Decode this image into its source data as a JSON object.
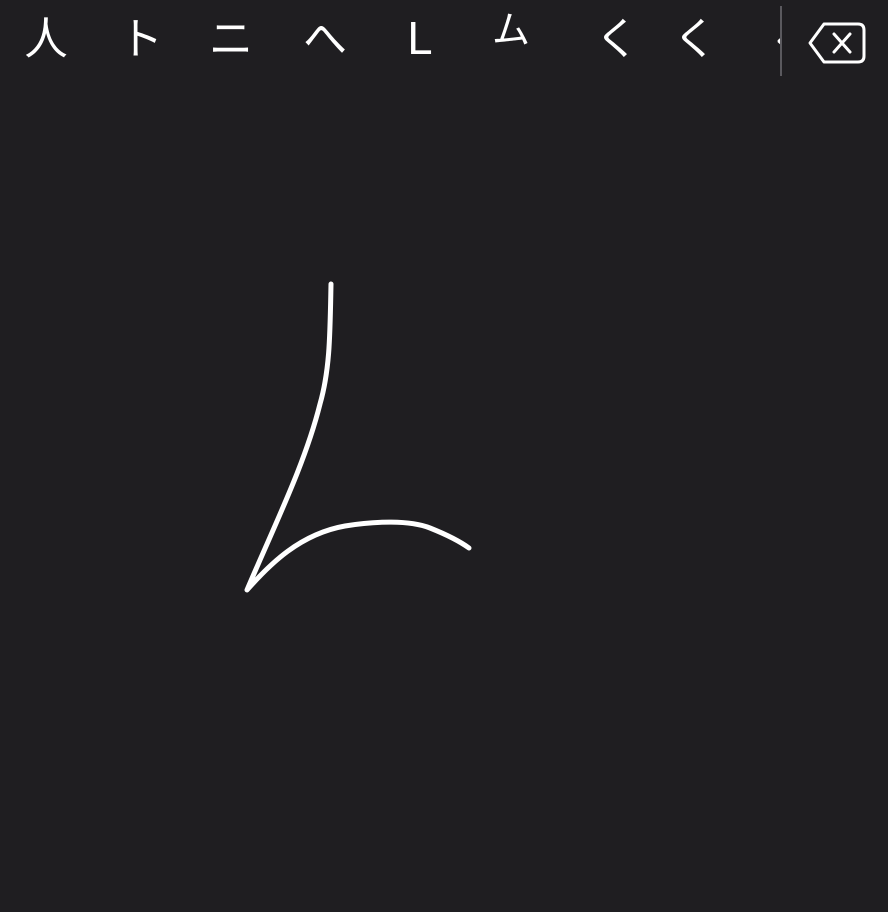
{
  "candidates": [
    {
      "label": "人"
    },
    {
      "label": "ト"
    },
    {
      "label": "ニ"
    },
    {
      "label": "へ"
    },
    {
      "label": "L"
    },
    {
      "label": "ム"
    },
    {
      "label": "く"
    },
    {
      "label": "く"
    },
    {
      "label": "‹"
    }
  ],
  "icons": {
    "delete": "delete-backspace-icon"
  },
  "colors": {
    "background": "#1f1e21",
    "ink": "#ffffff",
    "divider": "#5a595e"
  }
}
